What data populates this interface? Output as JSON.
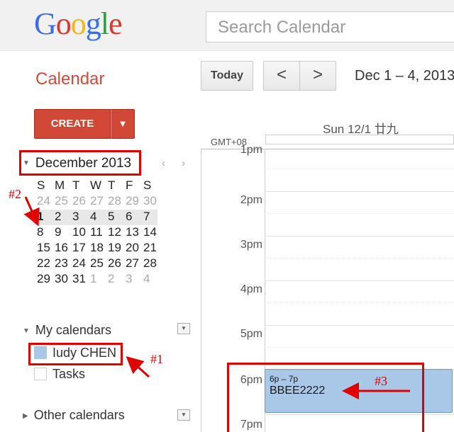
{
  "header": {
    "logo": [
      "G",
      "o",
      "o",
      "g",
      "l",
      "e"
    ],
    "search_placeholder": "Search Calendar"
  },
  "app": {
    "title": "Calendar"
  },
  "toolbar": {
    "today_label": "Today",
    "prev_label": "<",
    "next_label": ">",
    "date_range": "Dec 1 – 4, 2013"
  },
  "create": {
    "label": "CREATE",
    "dropdown_label": "▼"
  },
  "mini_calendar": {
    "month_label": "December 2013",
    "prev_label": "‹",
    "next_label": "›",
    "weekdays": [
      "S",
      "M",
      "T",
      "W",
      "T",
      "F",
      "S"
    ],
    "weeks": [
      [
        "24",
        "25",
        "26",
        "27",
        "28",
        "29",
        "30"
      ],
      [
        "1",
        "2",
        "3",
        "4",
        "5",
        "6",
        "7"
      ],
      [
        "8",
        "9",
        "10",
        "11",
        "12",
        "13",
        "14"
      ],
      [
        "15",
        "16",
        "17",
        "18",
        "19",
        "20",
        "21"
      ],
      [
        "22",
        "23",
        "24",
        "25",
        "26",
        "27",
        "28"
      ],
      [
        "29",
        "30",
        "31",
        "1",
        "2",
        "3",
        "4"
      ]
    ]
  },
  "my_calendars": {
    "label": "My calendars",
    "items": [
      {
        "name": "Iudy CHEN",
        "color": "#a9c8e8"
      },
      {
        "name": "Tasks",
        "color": "#ffffff"
      }
    ]
  },
  "other_calendars": {
    "label": "Other calendars"
  },
  "day_view": {
    "day_header": "Sun 12/1 廿九",
    "timezone": "GMT+08",
    "hours": [
      "1pm",
      "2pm",
      "3pm",
      "4pm",
      "5pm",
      "6pm",
      "7pm"
    ]
  },
  "event": {
    "time": "6p – 7p",
    "title": "BBEE2222",
    "color": "#a9c8e8"
  },
  "annotations": {
    "one": "#1",
    "two": "#2",
    "three": "#3",
    "color": "#e00000"
  }
}
